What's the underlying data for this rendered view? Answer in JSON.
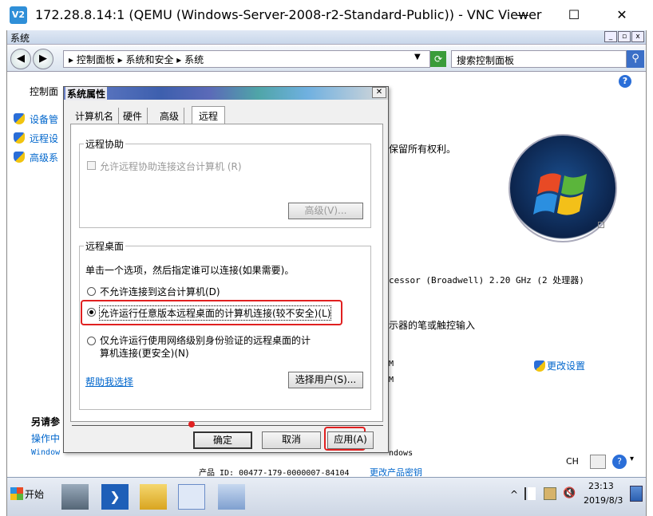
{
  "vnc": {
    "title": "172.28.8.14:1 (QEMU (Windows-Server-2008-r2-Standard-Public)) - VNC Viewer",
    "logo": "V2",
    "minimize": "—",
    "maximize": "☐",
    "close": "✕"
  },
  "remote_window": {
    "title": "系统",
    "min": "_",
    "max": "▫",
    "close": "x"
  },
  "address_bar": {
    "breadcrumb": "▸ 控制面板 ▸ 系统和安全 ▸ 系统",
    "search_placeholder": "搜索控制面板",
    "search_icon": "⚲"
  },
  "left_panel": {
    "home_link": "控制面",
    "links": [
      "设备管",
      "远程设",
      "高级系"
    ],
    "see_also_title": "另请参",
    "see_also_link": "操作中",
    "windows_frag": "Window"
  },
  "content": {
    "copyright": "保留所有权利。",
    "processor": "cessor (Broadwell)   2.20 GHz  (2 处理器)",
    "pen_input": "示器的笔或触控输入",
    "m1": "M",
    "m2": "M",
    "change_settings": "更改设置",
    "windows_right": "ndows",
    "product_id": "产品 ID: 00477-179-0000007-84104",
    "change_key": "更改产品密钥",
    "help_icon": "?"
  },
  "dialog": {
    "title": "系统属性",
    "close": "✕",
    "tabs": [
      "计算机名",
      "硬件",
      "高级",
      "远程"
    ],
    "remote_assist": {
      "label": "远程协助",
      "checkbox_label": "允许远程协助连接这台计算机 (R)",
      "advanced_button": "高级(V)..."
    },
    "remote_desktop": {
      "label": "远程桌面",
      "instruction": "单击一个选项，然后指定谁可以连接(如果需要)。",
      "option1": "不允许连接到这台计算机(D)",
      "option2": "允许运行任意版本远程桌面的计算机连接(较不安全)(L)",
      "option3_line1": "仅允许运行使用网络级别身份验证的远程桌面的计",
      "option3_line2": "算机连接(更安全)(N)",
      "help_link": "帮助我选择",
      "select_users_button": "选择用户(S)..."
    },
    "ok_button": "确定",
    "cancel_button": "取消",
    "apply_button": "应用(A)"
  },
  "taskbar": {
    "start_label": "开始",
    "lang": "CH",
    "time": "23:13",
    "date": "2019/8/3",
    "tray_chevron": "^"
  }
}
